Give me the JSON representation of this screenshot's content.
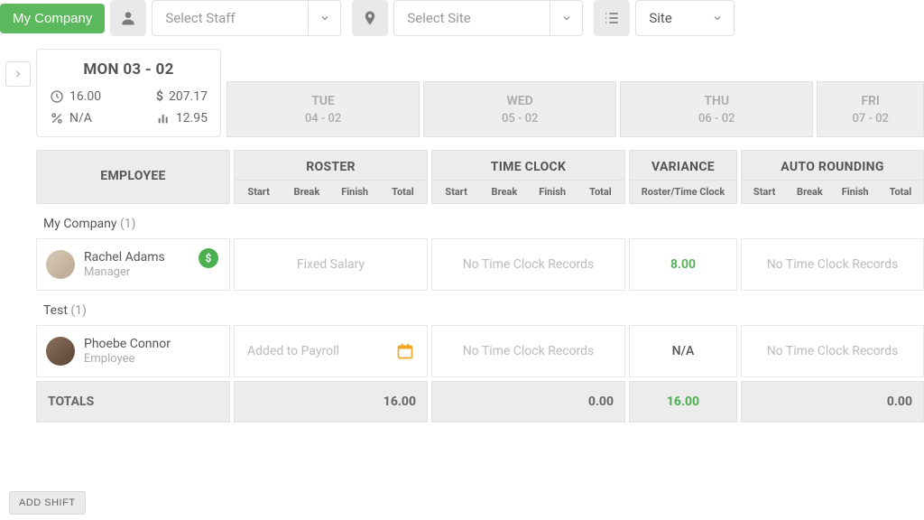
{
  "toolbar": {
    "company_label": "My Company",
    "staff_placeholder": "Select Staff",
    "site_placeholder": "Select Site",
    "group_by": "Site"
  },
  "days": {
    "active": {
      "label": "MON 03 - 02",
      "hours": "16.00",
      "cost": "207.17",
      "percent": "N/A",
      "metric": "12.95"
    },
    "rest": [
      {
        "label": "TUE",
        "sub": "04 - 02"
      },
      {
        "label": "WED",
        "sub": "05 - 02"
      },
      {
        "label": "THU",
        "sub": "06 - 02"
      },
      {
        "label": "FRI",
        "sub": "07 - 02"
      }
    ]
  },
  "columns": {
    "employee": "EMPLOYEE",
    "roster": "ROSTER",
    "timeclock": "TIME CLOCK",
    "variance": "VARIANCE",
    "variance_sub": "Roster/Time Clock",
    "auto": "AUTO ROUNDING",
    "sub": {
      "start": "Start",
      "break": "Break",
      "finish": "Finish",
      "total": "Total"
    }
  },
  "groups": [
    {
      "name": "My Company",
      "count": "(1)",
      "rows": [
        {
          "name": "Rachel Adams",
          "role": "Manager",
          "dollar": true,
          "avatar": "a",
          "roster": "Fixed Salary",
          "clock": "No Time Clock Records",
          "variance": "8.00",
          "variance_na": false,
          "auto": "No Time Clock Records",
          "roster_mode": "text"
        }
      ]
    },
    {
      "name": "Test",
      "count": "(1)",
      "rows": [
        {
          "name": "Phoebe Connor",
          "role": "Employee",
          "dollar": false,
          "avatar": "b",
          "roster": "Added to Payroll",
          "clock": "No Time Clock Records",
          "variance": "N/A",
          "variance_na": true,
          "auto": "No Time Clock Records",
          "roster_mode": "added"
        }
      ]
    }
  ],
  "totals": {
    "label": "TOTALS",
    "roster": "16.00",
    "clock": "0.00",
    "variance": "16.00",
    "auto": "0.00"
  },
  "bottom": {
    "add_shift": "ADD SHIFT"
  }
}
